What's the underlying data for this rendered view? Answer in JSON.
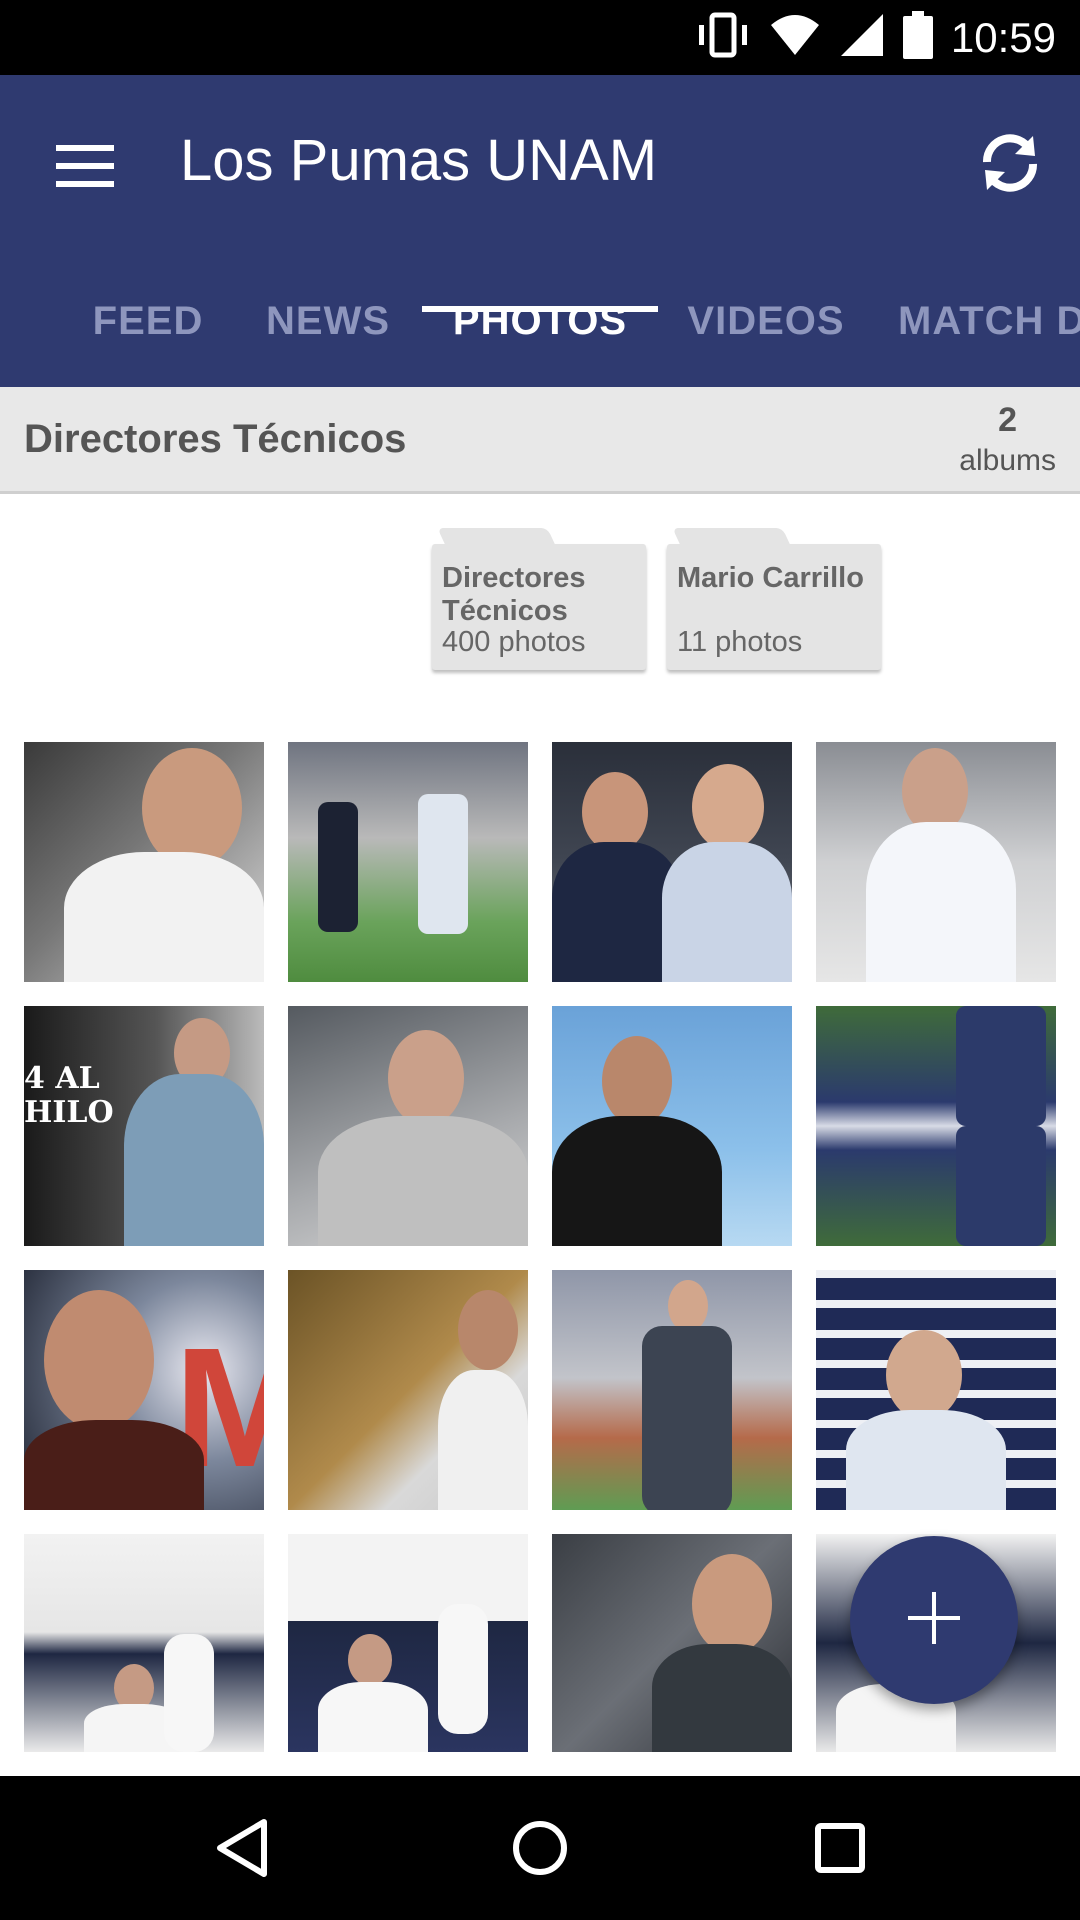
{
  "status_bar": {
    "time": "10:59",
    "icons": [
      "vibrate-icon",
      "wifi-icon",
      "signal-icon",
      "battery-icon"
    ]
  },
  "app_bar": {
    "title": "Los Pumas UNAM",
    "menu_icon": "hamburger-menu-icon",
    "refresh_icon": "refresh-icon",
    "background": "#2f3a70"
  },
  "tabs": [
    {
      "label": "FEED",
      "active": false
    },
    {
      "label": "NEWS",
      "active": false
    },
    {
      "label": "PHOTOS",
      "active": true
    },
    {
      "label": "VIDEOS",
      "active": false
    },
    {
      "label": "MATCH D",
      "active": false
    }
  ],
  "section": {
    "title": "Directores Técnicos",
    "album_count": "2",
    "album_count_label": "albums"
  },
  "albums": [
    {
      "name": "Directores Técnicos",
      "count": "400 photos"
    },
    {
      "name": "Mario Carrillo",
      "count": "11 photos"
    }
  ],
  "photos": [
    "photo-man-in-car",
    "photo-coaches-on-field",
    "photo-coaches-handshake",
    "photo-coach-white-shirt",
    "photo-coach-4-al-hilo",
    "photo-coach-seated-stadium",
    "photo-coach-waving",
    "photo-coach-reflection",
    "photo-coach-portrait",
    "photo-coach-with-mural",
    "photo-coach-walking-field",
    "photo-press-conference",
    "photo-press-room-1",
    "photo-press-room-2",
    "photo-coach-in-crowd",
    "photo-press-room-3"
  ],
  "fab": {
    "icon": "plus-icon"
  },
  "nav_bar": {
    "icons": [
      "back-icon",
      "home-icon",
      "recents-icon"
    ]
  }
}
